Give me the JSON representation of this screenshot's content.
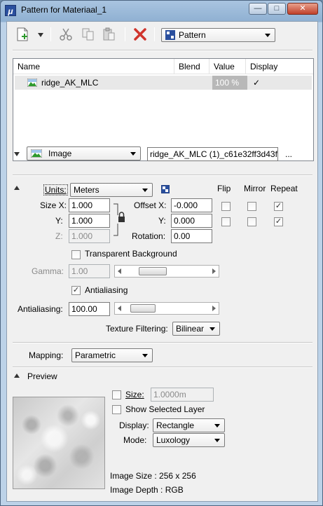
{
  "window": {
    "title": "Pattern for Materiaal_1",
    "app_icon": "microstation-logo",
    "controls": {
      "minimize": "—",
      "maximize": "□",
      "close": "✕"
    }
  },
  "toolbar": {
    "pattern_type": "Pattern",
    "icons": [
      "new-icon",
      "cut-icon",
      "copy-icon",
      "paste-icon",
      "delete-icon"
    ]
  },
  "layer_table": {
    "columns": [
      "Name",
      "Blend",
      "Value",
      "Display"
    ],
    "rows": [
      {
        "name": "ridge_AK_MLC (1)_c61e32ff3d43f...",
        "blend": "",
        "value": "100 %",
        "display": "✓"
      }
    ]
  },
  "source": {
    "type": "Image",
    "file": "ridge_AK_MLC (1)_c61e32ff3d43fd",
    "browse": "..."
  },
  "units": {
    "label": "Units:",
    "value": "Meters"
  },
  "headers": {
    "flip": "Flip",
    "mirror": "Mirror",
    "repeat": "Repeat"
  },
  "size": {
    "x_label": "Size X:",
    "x": "1.000",
    "y_label": "Y:",
    "y": "1.000",
    "z_label": "Z:",
    "z": "1.000"
  },
  "offset": {
    "x_label": "Offset X:",
    "x": "-0.000",
    "y_label": "Y:",
    "y": "0.000"
  },
  "rotation": {
    "label": "Rotation:",
    "value": "0.00"
  },
  "flip": {
    "x": false,
    "y": false
  },
  "mirror": {
    "x": false,
    "y": false
  },
  "repeat": {
    "x": true,
    "y": true
  },
  "transparent_background": {
    "label": "Transparent Background",
    "checked": false
  },
  "gamma": {
    "label": "Gamma:",
    "value": "1.00"
  },
  "antialiasing_check": {
    "label": "Antialiasing",
    "checked": true
  },
  "antialiasing": {
    "label": "Antialiasing:",
    "value": "100.00"
  },
  "texture_filtering": {
    "label": "Texture Filtering:",
    "value": "Bilinear"
  },
  "mapping": {
    "label": "Mapping:",
    "value": "Parametric"
  },
  "preview": {
    "title": "Preview",
    "size_label": "Size:",
    "size_value": "1.0000m",
    "size_checked": false,
    "show_selected_layer": "Show Selected Layer",
    "show_checked": false,
    "display_label": "Display:",
    "display_value": "Rectangle",
    "mode_label": "Mode:",
    "mode_value": "Luxology",
    "image_size": "Image Size : 256 x 256",
    "image_depth": "Image Depth : RGB"
  },
  "colors": {
    "accent": "#2a4f9e",
    "delete_red": "#d0342c",
    "titlebar": "#a9c4e0"
  }
}
